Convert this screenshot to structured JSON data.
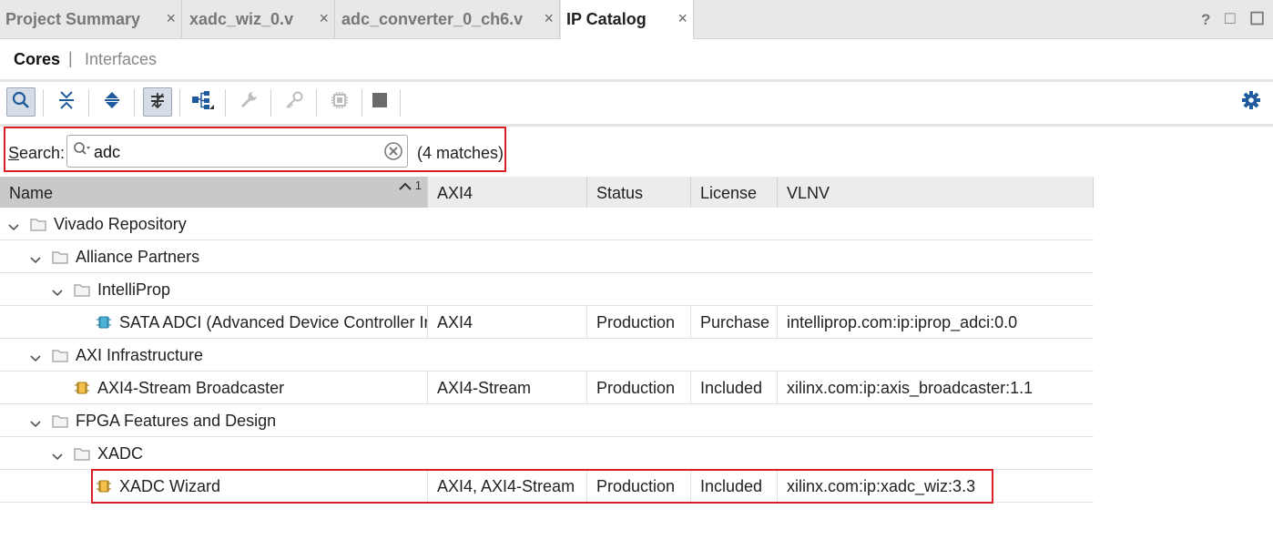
{
  "tabs": [
    {
      "label": "Project Summary",
      "close": "×"
    },
    {
      "label": "xadc_wiz_0.v",
      "close": "×"
    },
    {
      "label": "adc_converter_0_ch6.v",
      "close": "×"
    },
    {
      "label": "IP Catalog",
      "close": "×"
    }
  ],
  "window_controls": {
    "help": "?",
    "restore": "□",
    "maximize": "☐"
  },
  "subtabs": {
    "cores": "Cores",
    "separator": "|",
    "interfaces": "Interfaces"
  },
  "toolbar": {
    "icons": [
      "search-icon",
      "collapse-all-icon",
      "expand-all-icon",
      "filter-icon",
      "hierarchy-icon",
      "wrench-icon",
      "key-icon",
      "chip-icon",
      "stop-icon"
    ],
    "settings": "gear-icon"
  },
  "search": {
    "label_prefix": "S",
    "label_rest": "earch:",
    "value": "adc",
    "matches": "(4 matches)"
  },
  "columns": {
    "name": "Name",
    "sort_indicator": "1",
    "axi4": "AXI4",
    "status": "Status",
    "license": "License",
    "vlnv": "VLNV"
  },
  "rows": [
    {
      "name": "Vivado Repository",
      "axi": "",
      "status": "",
      "license": "",
      "vlnv": ""
    },
    {
      "name": "Alliance Partners",
      "axi": "",
      "status": "",
      "license": "",
      "vlnv": ""
    },
    {
      "name": "IntelliProp",
      "axi": "",
      "status": "",
      "license": "",
      "vlnv": ""
    },
    {
      "name": "SATA ADCI (Advanced Device Controller In",
      "axi": "AXI4",
      "status": "Production",
      "license": "Purchase",
      "vlnv": "intelliprop.com:ip:iprop_adci:0.0"
    },
    {
      "name": "AXI Infrastructure",
      "axi": "",
      "status": "",
      "license": "",
      "vlnv": ""
    },
    {
      "name": "AXI4-Stream Broadcaster",
      "axi": "AXI4-Stream",
      "status": "Production",
      "license": "Included",
      "vlnv": "xilinx.com:ip:axis_broadcaster:1.1"
    },
    {
      "name": "FPGA Features and Design",
      "axi": "",
      "status": "",
      "license": "",
      "vlnv": ""
    },
    {
      "name": "XADC",
      "axi": "",
      "status": "",
      "license": "",
      "vlnv": ""
    },
    {
      "name": "XADC Wizard",
      "axi": "AXI4, AXI4-Stream",
      "status": "Production",
      "license": "Included",
      "vlnv": "xilinx.com:ip:xadc_wiz:3.3"
    }
  ],
  "colors": {
    "highlight": "#d9202a",
    "accent": "#1e5a9c"
  }
}
